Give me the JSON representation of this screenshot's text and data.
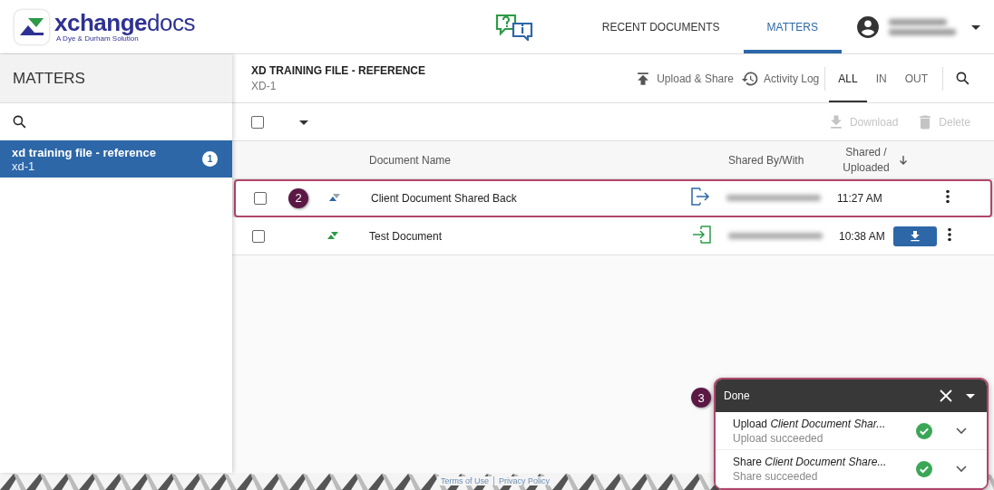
{
  "header": {
    "logo": {
      "name": "**xchange**docs",
      "tagline": "A Dye & Durham Solution"
    },
    "nav": [
      {
        "label": "RECENT DOCUMENTS",
        "selected": false
      },
      {
        "label": "MATTERS",
        "selected": true
      }
    ]
  },
  "sidebar": {
    "title": "MATTERS",
    "items": [
      {
        "name": "xd training file - reference",
        "code": "xd-1",
        "count": "1",
        "selected": true
      }
    ]
  },
  "matter": {
    "title": "XD TRAINING FILE - REFERENCE",
    "code": "XD-1",
    "actions": [
      {
        "kind": "upload",
        "label": "Upload & Share"
      },
      {
        "kind": "history",
        "label": "Activity Log"
      }
    ],
    "filters": [
      {
        "label": "ALL",
        "selected": true
      },
      {
        "label": "IN",
        "selected": false
      },
      {
        "label": "OUT",
        "selected": false
      }
    ]
  },
  "toolbar": {
    "select_all": {
      "checked": false
    },
    "actions": [
      {
        "kind": "download",
        "label": "Download",
        "disabled": true
      },
      {
        "kind": "delete",
        "label": "Delete",
        "disabled": true
      }
    ]
  },
  "table": {
    "columns": [
      "Document Name",
      "Shared By/With",
      "Shared / Uploaded"
    ],
    "rows": [
      {
        "name": "Client Document Shared Back",
        "kind": "out",
        "time": "11:27 AM",
        "checked": false,
        "download": false,
        "callout": "2"
      },
      {
        "name": "Test Document",
        "kind": "in",
        "time": "10:38 AM",
        "checked": false,
        "download": true
      }
    ]
  },
  "toast": {
    "title": "Done",
    "callout": "3",
    "items": [
      {
        "text": "Upload *Client Document Shar...*",
        "status": "Upload succeeded",
        "succeeded": true
      },
      {
        "text": "Share *Client Document Share...*",
        "status": "Share succeeded",
        "succeeded": true
      }
    ]
  },
  "footer": {
    "links": [
      "Terms of Use",
      "Privacy Policy"
    ]
  }
}
